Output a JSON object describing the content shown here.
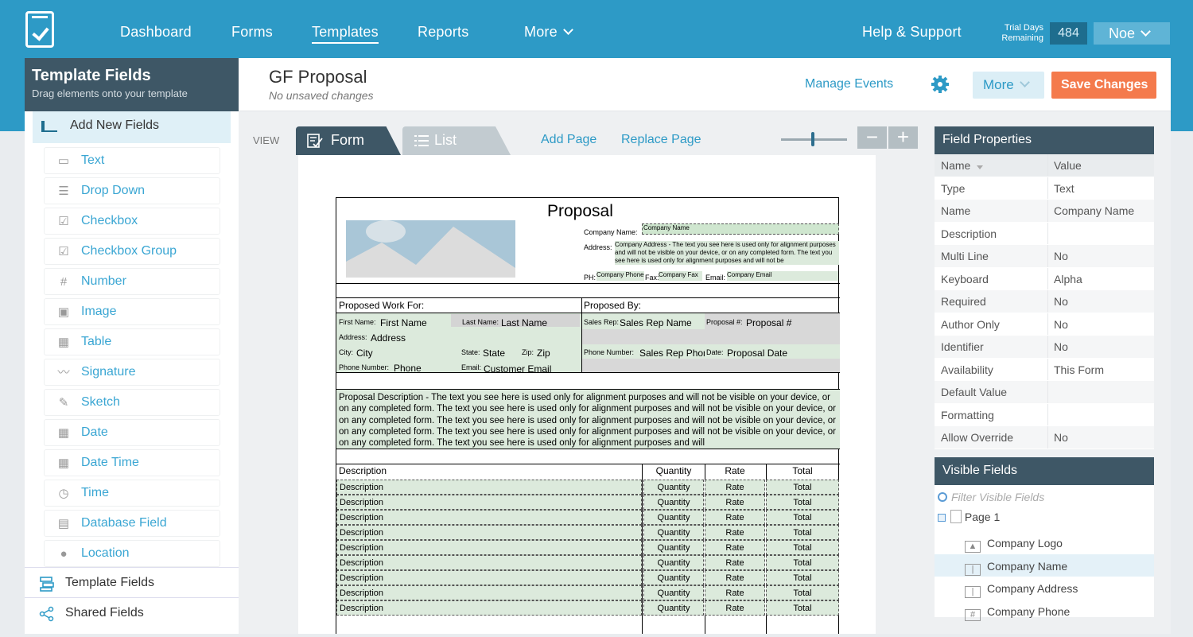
{
  "nav": {
    "dashboard": "Dashboard",
    "forms": "Forms",
    "templates": "Templates",
    "reports": "Reports",
    "more": "More",
    "help": "Help & Support",
    "trial_label": "Trial Days Remaining",
    "trial_days": "484",
    "user": "Noe"
  },
  "left": {
    "title": "Template Fields",
    "subtitle": "Drag elements onto your template",
    "add_new": "Add New Fields",
    "fields": [
      "Text",
      "Drop Down",
      "Checkbox",
      "Checkbox Group",
      "Number",
      "Image",
      "Table",
      "Signature",
      "Sketch",
      "Date",
      "Date Time",
      "Time",
      "Database Field",
      "Location"
    ],
    "template_fields": "Template Fields",
    "shared_fields": "Shared Fields"
  },
  "header": {
    "title": "GF Proposal",
    "status": "No unsaved changes",
    "manage_events": "Manage Events",
    "more": "More",
    "save": "Save Changes"
  },
  "view": {
    "label": "VIEW",
    "form_tab": "Form",
    "list_tab": "List",
    "add_page": "Add Page",
    "replace_page": "Replace Page",
    "zoom_level": 0.5,
    "minus": "−",
    "plus": "+"
  },
  "form": {
    "title": "Proposal",
    "company_name_label": "Company Name:",
    "company_name": "Company Name",
    "address_label": "Address:",
    "company_address": "Company Address - The text you see here is used only for alignment purposes and will not be visible on your device, or on any completed form. The text you see here is used only for alignment purposes and will not be",
    "ph_label": "PH:",
    "company_phone": "Company Phone",
    "fax_label": "Fax:",
    "company_fax": "Company Fax",
    "email_label": "Email:",
    "company_email": "Company Email",
    "proposed_for": "Proposed Work For:",
    "proposed_by": "Proposed By:",
    "first_name_label": "First Name:",
    "first_name": "First Name",
    "last_name_label": "Last Name:",
    "last_name": "Last Name",
    "address2_label": "Address:",
    "address2": "Address",
    "city_label": "City:",
    "city": "City",
    "state_label": "State:",
    "state": "State",
    "zip_label": "Zip:",
    "zip": "Zip",
    "phone_label": "Phone Number:",
    "phone": "Phone",
    "email2_label": "Email:",
    "email2": "Customer Email",
    "sales_rep_label": "Sales Rep:",
    "sales_rep": "Sales Rep Name",
    "proposal_no_label": "Proposal #:",
    "proposal_no": "Proposal #",
    "sales_phone_label": "Phone Number:",
    "sales_phone": "Sales Rep Phone",
    "date_label": "Date:",
    "proposal_date": "Proposal Date",
    "description": "Proposal Description - The text you see here is used only for alignment purposes and will not be visible on your device, or on any completed form. The text you see here is used only for alignment purposes and will not be visible on your device, or on any completed form. The text you see here is used only for alignment purposes and will not be visible on your device, or on any completed form. The text you see here is used only for alignment purposes and will not be visible on your device, or on any completed form. The text you see here is used only for alignment purposes and will",
    "table_headers": [
      "Description",
      "Quantity",
      "Rate",
      "Total"
    ],
    "rows": [
      [
        "Description",
        "Quantity",
        "Rate",
        "Total"
      ],
      [
        "Description",
        "Quantity",
        "Rate",
        "Total"
      ],
      [
        "Description",
        "Quantity",
        "Rate",
        "Total"
      ],
      [
        "Description",
        "Quantity",
        "Rate",
        "Total"
      ],
      [
        "Description",
        "Quantity",
        "Rate",
        "Total"
      ],
      [
        "Description",
        "Quantity",
        "Rate",
        "Total"
      ],
      [
        "Description",
        "Quantity",
        "Rate",
        "Total"
      ],
      [
        "Description",
        "Quantity",
        "Rate",
        "Total"
      ],
      [
        "Description",
        "Quantity",
        "Rate",
        "Total"
      ]
    ]
  },
  "properties": {
    "title": "Field Properties",
    "col_name": "Name",
    "col_value": "Value",
    "rows": [
      [
        "Type",
        "Text"
      ],
      [
        "Name",
        "Company Name"
      ],
      [
        "Description",
        ""
      ],
      [
        "Multi Line",
        "No"
      ],
      [
        "Keyboard",
        "Alpha"
      ],
      [
        "Required",
        "No"
      ],
      [
        "Author Only",
        "No"
      ],
      [
        "Identifier",
        "No"
      ],
      [
        "Availability",
        "This Form"
      ],
      [
        "Default Value",
        ""
      ],
      [
        "Formatting",
        ""
      ],
      [
        "Allow Override",
        "No"
      ]
    ]
  },
  "visible": {
    "title": "Visible Fields",
    "filter_placeholder": "Filter Visible Fields",
    "page": "Page 1",
    "items": [
      "Company Logo",
      "Company Name",
      "Company Address",
      "Company Phone"
    ]
  },
  "colors": {
    "topbar": "#2d9ac6",
    "accent": "#2d9ac6",
    "dark": "#3e5766",
    "save": "#f47a4c",
    "field_fill": "#dceadc"
  }
}
